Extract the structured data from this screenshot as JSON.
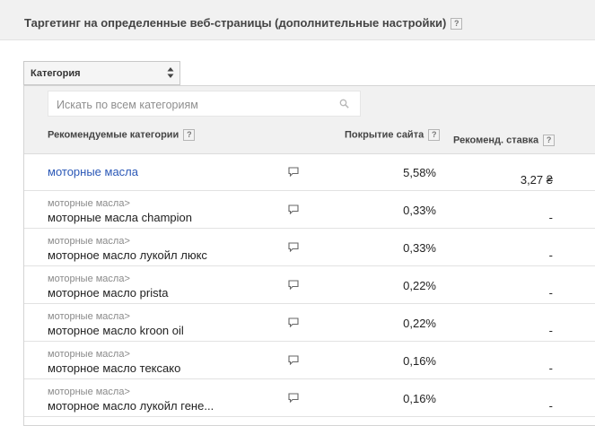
{
  "header": {
    "title": "Таргетинг на определенные веб-страницы (дополнительные настройки)",
    "help": "?"
  },
  "category_select": {
    "label": "Категория"
  },
  "search": {
    "placeholder": "Искать по всем категориям"
  },
  "columns": {
    "category": "Рекомендуемые категории",
    "coverage": "Покрытие сайта",
    "bid": "Рекоменд. ставка",
    "help": "?"
  },
  "rows": [
    {
      "parent": "",
      "name": "моторные масла",
      "coverage": "5,58%",
      "bid": "3,27 ₴"
    },
    {
      "parent": "моторные масла>",
      "name": "моторные масла champion",
      "coverage": "0,33%",
      "bid": "-"
    },
    {
      "parent": "моторные масла>",
      "name": "моторное масло лукойл люкс",
      "coverage": "0,33%",
      "bid": "-"
    },
    {
      "parent": "моторные масла>",
      "name": "моторное масло prista",
      "coverage": "0,22%",
      "bid": "-"
    },
    {
      "parent": "моторные масла>",
      "name": "моторное масло kroon oil",
      "coverage": "0,22%",
      "bid": "-"
    },
    {
      "parent": "моторные масла>",
      "name": "моторное масло тексако",
      "coverage": "0,16%",
      "bid": "-"
    },
    {
      "parent": "моторные масла>",
      "name": "моторное масло лукойл гене...",
      "coverage": "0,16%",
      "bid": "-"
    }
  ],
  "icons": {
    "search": "search-icon",
    "comment": "comment-icon",
    "sort": "sort-arrows-icon"
  },
  "colors": {
    "link": "#2b58b7",
    "header_bg": "#f1f1f1"
  }
}
